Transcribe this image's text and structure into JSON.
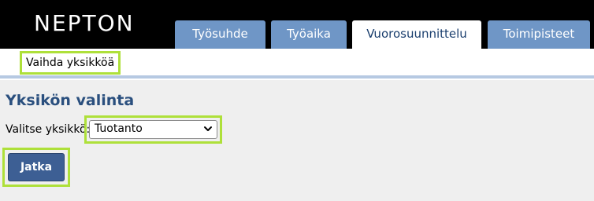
{
  "header": {
    "logo": "NEPTON",
    "tabs": [
      {
        "label": "Työsuhde",
        "active": false
      },
      {
        "label": "Työaika",
        "active": false
      },
      {
        "label": "Vuorosuunnittelu",
        "active": true
      },
      {
        "label": "Toimipisteet",
        "active": false
      }
    ]
  },
  "subnav": {
    "link_label": "Vaihda yksikköä"
  },
  "main": {
    "title": "Yksikön valinta",
    "unit_label": "Valitse yksikkö:",
    "unit_select": {
      "value": "Tuotanto",
      "icon": "chevron-down-icon"
    },
    "continue_button": "Jatka"
  },
  "colors": {
    "topbar": "#000000",
    "tab_inactive": "#6f96c6",
    "tab_active": "#ffffff",
    "title": "#2a4f7e",
    "button": "#3d5f94",
    "highlight": "#aee03a",
    "content_bg": "#efefef"
  }
}
